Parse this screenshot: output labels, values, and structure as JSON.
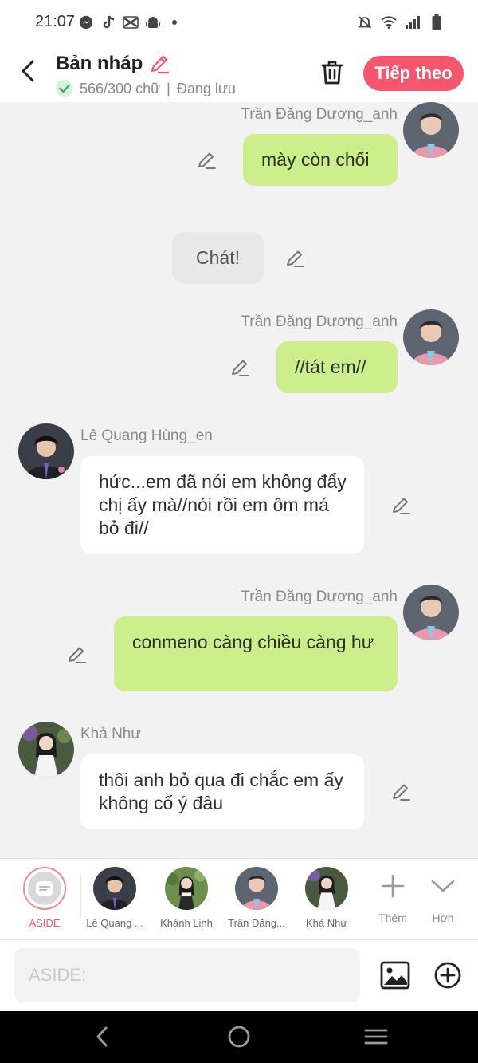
{
  "status_bar": {
    "time": "21:07"
  },
  "header": {
    "title": "Bản nháp",
    "word_count": "566/300 chữ",
    "separator": "|",
    "save_status": "Đang lưu",
    "next_label": "Tiếp theo"
  },
  "colors": {
    "accent": "#f4566e",
    "my_bubble": "#ccef8c",
    "other_bubble": "#ffffff",
    "narration_bubble": "#e8e8e8"
  },
  "messages": [
    {
      "speaker": "Trần Đăng Dương_anh",
      "text": "mày còn chối",
      "side": "right"
    },
    {
      "speaker": "",
      "text": "Chát!",
      "side": "center"
    },
    {
      "speaker": "Trần Đăng Dương_anh",
      "text": "//tát em//",
      "side": "right"
    },
    {
      "speaker": "Lê Quang Hùng_en",
      "text": "hức...em đã nói em không đẩy chị ấy mà//nói rồi em ôm má bỏ đi//",
      "side": "left"
    },
    {
      "speaker": "Trần Đăng Dương_anh",
      "text": "conmeno càng chiều càng hư",
      "side": "right"
    },
    {
      "speaker": "Khả Như",
      "text": "thôi anh bỏ qua đi chắc em ấy không cố ý đâu",
      "side": "left"
    }
  ],
  "characters": [
    {
      "label": "ASIDE"
    },
    {
      "label": "Lê Quang ..."
    },
    {
      "label": "Khánh Linh"
    },
    {
      "label": "Trần Đăng..."
    },
    {
      "label": "Khả Như"
    }
  ],
  "tools": {
    "add_label": "Thêm",
    "more_label": "Hơn"
  },
  "input": {
    "placeholder": "ASIDE:"
  }
}
